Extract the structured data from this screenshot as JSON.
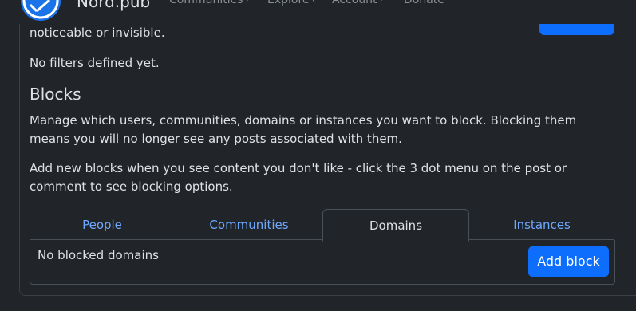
{
  "header": {
    "brand": "Nord.pub",
    "nav": [
      {
        "label": "Communities"
      },
      {
        "label": "Explore"
      },
      {
        "label": "Account"
      },
      {
        "label": "Donate"
      }
    ]
  },
  "filters": {
    "clipped_text": "noticeable or invisible.",
    "empty_text": "No filters defined yet."
  },
  "blocks": {
    "heading": "Blocks",
    "description": "Manage which users, communities, domains or instances you want to block. Blocking them means you will no longer see any posts associated with them.",
    "hint": "Add new blocks when you see content you don't like - click the 3 dot menu on the post or comment to see blocking options.",
    "tabs": [
      {
        "label": "People",
        "active": false
      },
      {
        "label": "Communities",
        "active": false
      },
      {
        "label": "Domains",
        "active": true
      },
      {
        "label": "Instances",
        "active": false
      }
    ],
    "panel": {
      "empty_text": "No blocked domains",
      "add_label": "Add block"
    }
  },
  "colors": {
    "background": "#212529",
    "accent": "#0d6efd",
    "link": "#6ea8fe",
    "text": "#dee2e6"
  }
}
